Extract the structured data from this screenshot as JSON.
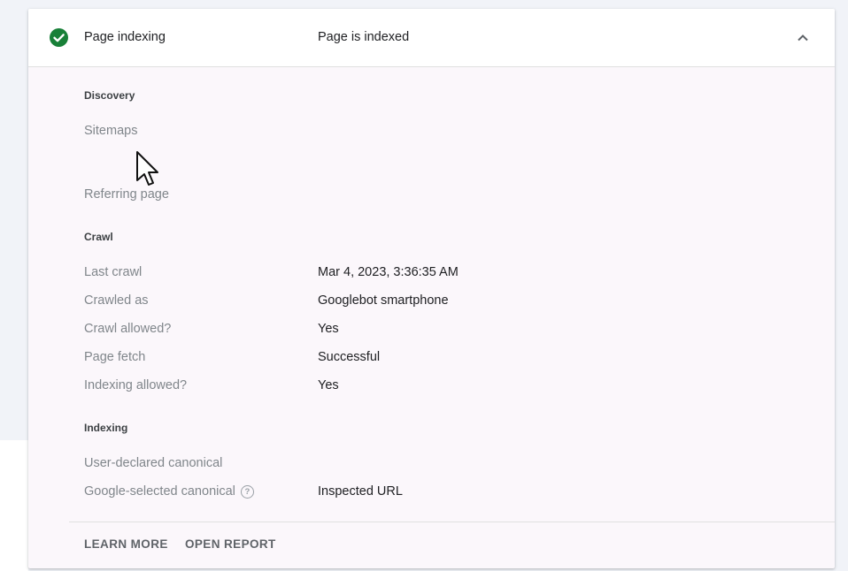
{
  "header": {
    "title": "Page indexing",
    "status": "Page is indexed",
    "status_color": "#188038"
  },
  "discovery": {
    "heading": "Discovery",
    "sitemaps_label": "Sitemaps",
    "referring_label": "Referring page"
  },
  "crawl": {
    "heading": "Crawl",
    "rows": [
      {
        "label": "Last crawl",
        "value": "Mar 4, 2023, 3:36:35 AM"
      },
      {
        "label": "Crawled as",
        "value": "Googlebot smartphone"
      },
      {
        "label": "Crawl allowed?",
        "value": "Yes"
      },
      {
        "label": "Page fetch",
        "value": "Successful"
      },
      {
        "label": "Indexing allowed?",
        "value": "Yes"
      }
    ]
  },
  "indexing": {
    "heading": "Indexing",
    "user_canonical_label": "User-declared canonical",
    "google_canonical_label": "Google-selected canonical",
    "google_canonical_value": "Inspected URL",
    "help_glyph": "?"
  },
  "footer": {
    "learn_more": "LEARN MORE",
    "open_report": "OPEN REPORT"
  }
}
